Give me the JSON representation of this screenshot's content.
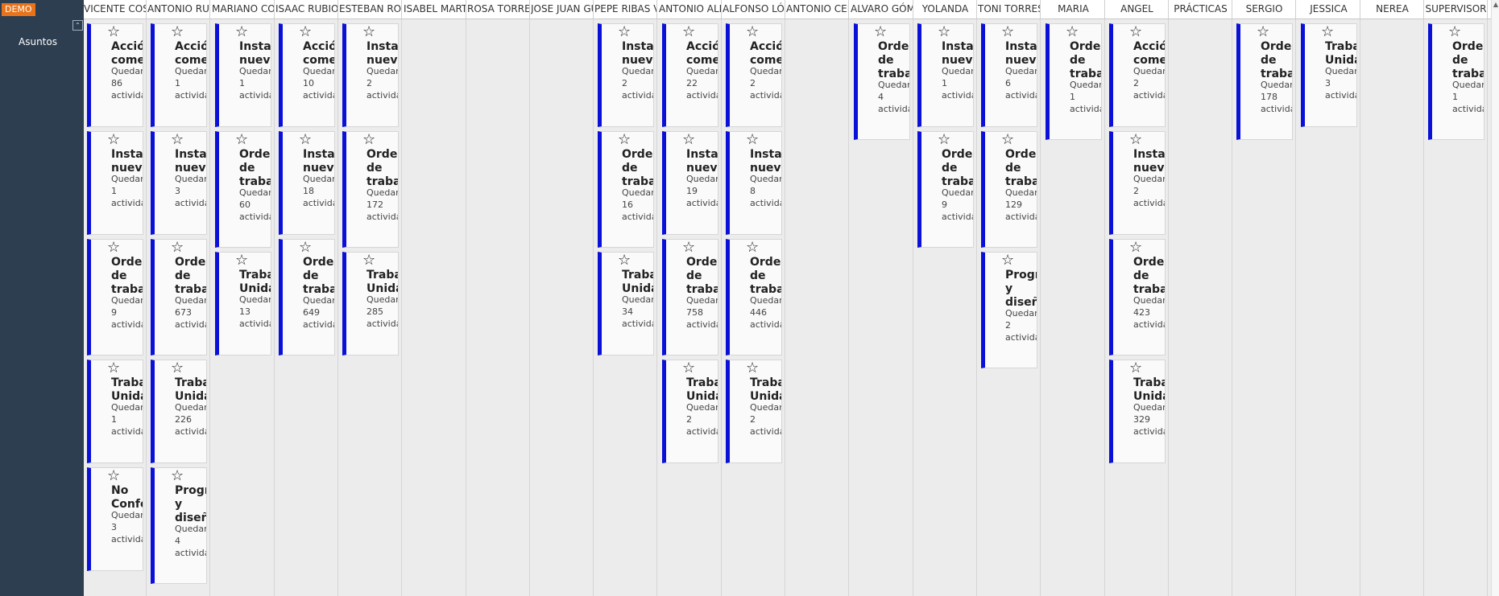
{
  "app": {
    "badge": "DEMO",
    "sidebar_item": "Asuntos",
    "collapse_glyph": "⌃"
  },
  "icons": {
    "star": "star-icon"
  },
  "colors": {
    "card_accent": "#0a10d8",
    "badge": "#e8731a",
    "sidebar": "#2c3e50"
  },
  "columns": [
    {
      "name": "VICENTE COS",
      "cards": [
        {
          "title": "Acción\ncomer",
          "sub1": "Quedan",
          "count": "86",
          "sub2": "actividad"
        },
        {
          "title": "Instala\nnueva",
          "sub1": "Quedan",
          "count": "1",
          "sub2": "actividad"
        },
        {
          "title": "Orden\nde\ntrabaj",
          "sub1": "Quedan",
          "count": "9",
          "sub2": "actividad"
        },
        {
          "title": "Trabaj\nUnidad",
          "sub1": "Quedan",
          "count": "1",
          "sub2": "actividad"
        },
        {
          "title": "No\nConfo",
          "sub1": "Quedan",
          "count": "3",
          "sub2": "actividad"
        }
      ]
    },
    {
      "name": "ANTONIO RUB",
      "cards": [
        {
          "title": "Acción\ncomer",
          "sub1": "Quedan",
          "count": "1",
          "sub2": "actividad"
        },
        {
          "title": "Instala\nnueva",
          "sub1": "Quedan",
          "count": "3",
          "sub2": "actividad"
        },
        {
          "title": "Orden\nde\ntrabaj",
          "sub1": "Quedan",
          "count": "673",
          "sub2": "actividad"
        },
        {
          "title": "Trabaj\nUnidad",
          "sub1": "Quedan",
          "count": "226",
          "sub2": "actividad"
        },
        {
          "title": "Progra\ny\ndiseño",
          "sub1": "Quedan",
          "count": "4",
          "sub2": "actividad"
        }
      ]
    },
    {
      "name": "MARIANO COS",
      "cards": [
        {
          "title": "Instala\nnueva",
          "sub1": "Quedan",
          "count": "1",
          "sub2": "actividad"
        },
        {
          "title": "Orden\nde\ntrabaj",
          "sub1": "Quedan",
          "count": "60",
          "sub2": "actividad"
        },
        {
          "title": "Trabaj\nUnidad",
          "sub1": "Quedan",
          "count": "13",
          "sub2": "actividad"
        }
      ]
    },
    {
      "name": "ISAAC RUBIO",
      "cards": [
        {
          "title": "Acción\ncomer",
          "sub1": "Quedan",
          "count": "10",
          "sub2": "actividad"
        },
        {
          "title": "Instala\nnueva",
          "sub1": "Quedan",
          "count": "18",
          "sub2": "actividad"
        },
        {
          "title": "Orden\nde\ntrabaj",
          "sub1": "Quedan",
          "count": "649",
          "sub2": "actividad"
        }
      ]
    },
    {
      "name": "ESTEBAN ROI",
      "cards": [
        {
          "title": "Instala\nnueva",
          "sub1": "Quedan",
          "count": "2",
          "sub2": "actividad"
        },
        {
          "title": "Orden\nde\ntrabaj",
          "sub1": "Quedan",
          "count": "172",
          "sub2": "actividad"
        },
        {
          "title": "Trabaj\nUnidad",
          "sub1": "Quedan",
          "count": "285",
          "sub2": "actividad"
        }
      ]
    },
    {
      "name": "ISABEL MART",
      "cards": []
    },
    {
      "name": "ROSA TORRES",
      "cards": []
    },
    {
      "name": "JOSE JUAN GU",
      "cards": []
    },
    {
      "name": "PEPE RIBAS V",
      "cards": [
        {
          "title": "Instala\nnueva",
          "sub1": "Quedan",
          "count": "2",
          "sub2": "actividad"
        },
        {
          "title": "Orden\nde\ntrabaj",
          "sub1": "Quedan",
          "count": "16",
          "sub2": "actividad"
        },
        {
          "title": "Trabaj\nUnidad",
          "sub1": "Quedan",
          "count": "34",
          "sub2": "actividad"
        }
      ]
    },
    {
      "name": "ANTONIO ALF",
      "cards": [
        {
          "title": "Acción\ncomer",
          "sub1": "Quedan",
          "count": "22",
          "sub2": "actividad"
        },
        {
          "title": "Instala\nnueva",
          "sub1": "Quedan",
          "count": "19",
          "sub2": "actividad"
        },
        {
          "title": "Orden\nde\ntrabaj",
          "sub1": "Quedan",
          "count": "758",
          "sub2": "actividad"
        },
        {
          "title": "Trabaj\nUnidad",
          "sub1": "Quedan",
          "count": "2",
          "sub2": "actividad"
        }
      ]
    },
    {
      "name": "ALFONSO LÓP",
      "cards": [
        {
          "title": "Acción\ncomer",
          "sub1": "Quedan",
          "count": "2",
          "sub2": "actividad"
        },
        {
          "title": "Instala\nnueva",
          "sub1": "Quedan",
          "count": "8",
          "sub2": "actividad"
        },
        {
          "title": "Orden\nde\ntrabaj",
          "sub1": "Quedan",
          "count": "446",
          "sub2": "actividad"
        },
        {
          "title": "Trabaj\nUnidad",
          "sub1": "Quedan",
          "count": "2",
          "sub2": "actividad"
        }
      ]
    },
    {
      "name": "ANTONIO CER",
      "cards": []
    },
    {
      "name": "ALVARO GÓME",
      "cards": [
        {
          "title": "Orden\nde\ntrabaj",
          "sub1": "Quedan",
          "count": "4",
          "sub2": "actividad"
        }
      ]
    },
    {
      "name": "YOLANDA",
      "cards": [
        {
          "title": "Instala\nnueva",
          "sub1": "Quedan",
          "count": "1",
          "sub2": "actividad"
        },
        {
          "title": "Orden\nde\ntrabaj",
          "sub1": "Quedan",
          "count": "9",
          "sub2": "actividad"
        }
      ]
    },
    {
      "name": "TONI TORRES",
      "cards": [
        {
          "title": "Instala\nnueva",
          "sub1": "Quedan",
          "count": "6",
          "sub2": "actividad"
        },
        {
          "title": "Orden\nde\ntrabaj",
          "sub1": "Quedan",
          "count": "129",
          "sub2": "actividad"
        },
        {
          "title": "Progra\ny\ndiseño",
          "sub1": "Quedan",
          "count": "2",
          "sub2": "actividad"
        }
      ]
    },
    {
      "name": "MARIA",
      "cards": [
        {
          "title": "Orden\nde\ntrabaj",
          "sub1": "Quedan",
          "count": "1",
          "sub2": "actividad"
        }
      ]
    },
    {
      "name": "ANGEL",
      "cards": [
        {
          "title": "Acción\ncomer",
          "sub1": "Quedan",
          "count": "2",
          "sub2": "actividad"
        },
        {
          "title": "Instala\nnueva",
          "sub1": "Quedan",
          "count": "2",
          "sub2": "actividad"
        },
        {
          "title": "Orden\nde\ntrabaj",
          "sub1": "Quedan",
          "count": "423",
          "sub2": "actividad"
        },
        {
          "title": "Trabaj\nUnidad",
          "sub1": "Quedan",
          "count": "329",
          "sub2": "actividad"
        }
      ]
    },
    {
      "name": "PRÁCTICAS",
      "cards": []
    },
    {
      "name": "SERGIO",
      "cards": [
        {
          "title": "Orden\nde\ntrabaj",
          "sub1": "Quedan",
          "count": "178",
          "sub2": "actividad"
        }
      ]
    },
    {
      "name": "JESSICA",
      "cards": [
        {
          "title": "Trabaj\nUnidad",
          "sub1": "Quedan",
          "count": "3",
          "sub2": "actividad"
        }
      ]
    },
    {
      "name": "NEREA",
      "cards": []
    },
    {
      "name": "SUPERVISOR",
      "cards": [
        {
          "title": "Orden\nde\ntrabaj",
          "sub1": "Quedan",
          "count": "1",
          "sub2": "actividad"
        }
      ]
    }
  ]
}
